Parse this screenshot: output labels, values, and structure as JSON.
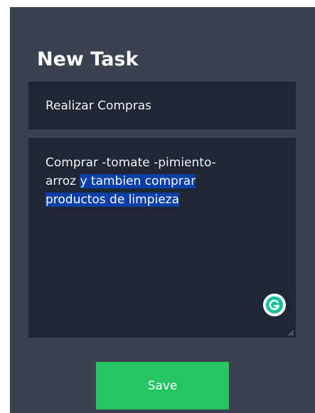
{
  "form": {
    "heading": "New Task",
    "title_value": "Realizar Compras",
    "description": {
      "line1": "Comprar -tomate -pimiento-",
      "line2_plain": "arroz ",
      "line2_selected": " y tambien comprar ",
      "line3_selected": "productos de limpieza"
    },
    "save_label": "Save"
  },
  "icons": {
    "grammarly": "grammarly-icon",
    "resize": "resize-handle-icon"
  },
  "colors": {
    "panel_bg": "#3a4250",
    "field_bg": "#1f2735",
    "selection": "#0a3ea8",
    "save_button": "#22c55e",
    "grammarly": "#15c39a"
  }
}
